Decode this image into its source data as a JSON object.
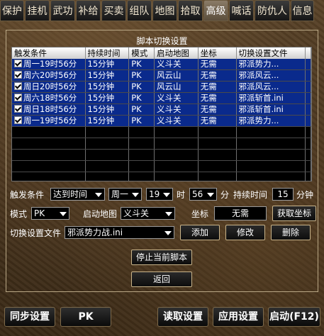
{
  "tabs": [
    "保护",
    "挂机",
    "武功",
    "补给",
    "买卖",
    "组队",
    "地图",
    "拾取",
    "高级",
    "喊话",
    "防仇人",
    "信息"
  ],
  "active_tab": "高级",
  "panel": {
    "title": "脚本切换设置",
    "columns": [
      "触发条件",
      "持续时间",
      "模式",
      "启动地图",
      "坐标",
      "切换设置文件"
    ],
    "rows": [
      {
        "trigger": "周一19时56分",
        "duration": "15分钟",
        "mode": "PK",
        "map": "义斗关",
        "coord": "无需",
        "file": "邪派势力...",
        "checked": true
      },
      {
        "trigger": "周六20时56分",
        "duration": "15分钟",
        "mode": "PK",
        "map": "风云山",
        "coord": "无需",
        "file": "邪派风云...",
        "checked": true
      },
      {
        "trigger": "周日20时56分",
        "duration": "15分钟",
        "mode": "PK",
        "map": "风云山",
        "coord": "无需",
        "file": "邪派风云...",
        "checked": true
      },
      {
        "trigger": "周六18时56分",
        "duration": "15分钟",
        "mode": "PK",
        "map": "义斗关",
        "coord": "无需",
        "file": "邪派斩首.ini",
        "checked": true
      },
      {
        "trigger": "周日18时56分",
        "duration": "15分钟",
        "mode": "PK",
        "map": "义斗关",
        "coord": "无需",
        "file": "邪派斩首.ini",
        "checked": true
      },
      {
        "trigger": "周一19时56分",
        "duration": "15分钟",
        "mode": "PK",
        "map": "义斗关",
        "coord": "无需",
        "file": "邪派势力...",
        "checked": true
      }
    ],
    "empty_rows": 5
  },
  "form": {
    "trigger_label": "触发条件",
    "trigger_type": "达到时间",
    "weekday": "周一",
    "hour": "19",
    "hour_unit": "时",
    "minute": "56",
    "minute_unit": "分",
    "duration_label": "持续时间",
    "duration_value": "15",
    "duration_unit": "分钟",
    "mode_label": "模式",
    "mode_value": "PK",
    "map_label": "启动地图",
    "map_value": "义斗关",
    "coord_label": "坐标",
    "coord_value": "无需",
    "get_coord_button": "获取坐标",
    "file_label": "切换设置文件",
    "file_value": "邪派势力战.ini",
    "add_button": "添加",
    "modify_button": "修改",
    "delete_button": "删除",
    "stop_button": "停止当前脚本",
    "back_button": "返回"
  },
  "bottom": {
    "sync_button": "同步设置",
    "mode_button": "PK",
    "read_button": "读取设置",
    "apply_button": "应用设置",
    "start_button": "启动(F12)"
  }
}
